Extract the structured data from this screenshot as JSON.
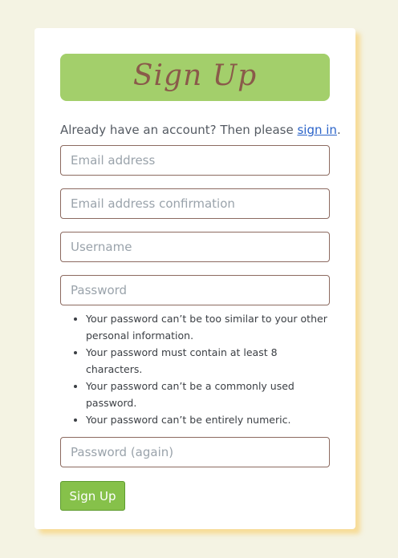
{
  "form": {
    "title": "Sign Up",
    "subtitle_prefix": "Already have an account? Then please ",
    "signin_link": "sign in",
    "subtitle_suffix": ".",
    "fields": {
      "email_placeholder": "Email address",
      "email_confirm_placeholder": "Email address confirmation",
      "username_placeholder": "Username",
      "password_placeholder": "Password",
      "password_again_placeholder": "Password (again)"
    },
    "password_help": [
      "Your password can’t be too similar to your other personal information.",
      "Your password must contain at least 8 characters.",
      "Your password can’t be a commonly used password.",
      "Your password can’t be entirely numeric."
    ],
    "submit_label": "Sign Up"
  },
  "colors": {
    "page_background": "#f4f3e3",
    "title_bar": "#a3cf6b",
    "title_text": "#8a5a4a",
    "field_border": "#8c6a60",
    "link": "#2a63c9",
    "button": "#86c14a",
    "card_shadow": "#fac85a"
  }
}
